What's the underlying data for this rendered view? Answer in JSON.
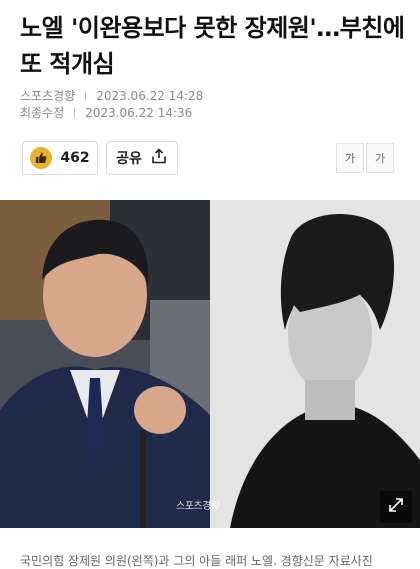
{
  "article": {
    "headline": "노엘 '이완용보다 못한 장제원'…부친에 또 적개심",
    "source": "스포츠경향",
    "published": "2023.06.22 14:28",
    "modified_label": "최종수정",
    "modified": "2023.06.22 14:36"
  },
  "actions": {
    "like_count": "462",
    "share_label": "공유",
    "font_small": "가",
    "font_large": "가"
  },
  "photo": {
    "watermark": "스포츠경향",
    "caption": "국민의힘 장제원 의원(왼쪽)과 그의 아들 래퍼 노엘. 경향신문 자료사진"
  },
  "colors": {
    "like_icon": "#e9b22a",
    "meta_text": "#8a8a8a"
  }
}
